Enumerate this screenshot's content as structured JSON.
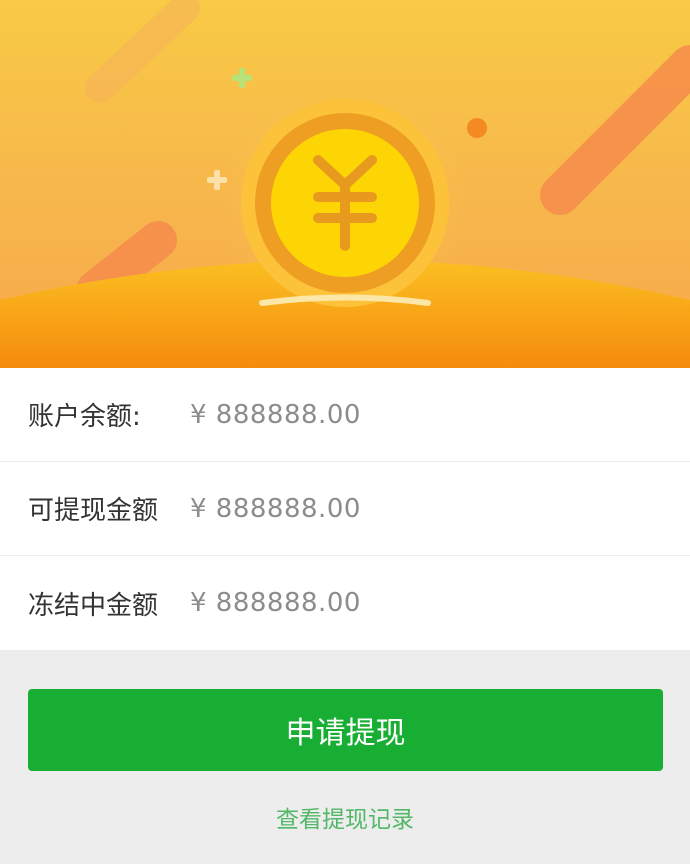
{
  "hero": {
    "icon": "yuan-coin-icon",
    "currency_symbol": "¥"
  },
  "balances": [
    {
      "label": "账户余额:",
      "value": "¥ 888888.00"
    },
    {
      "label": "可提现金额",
      "value": "¥ 888888.00"
    },
    {
      "label": "冻结中金额",
      "value": "¥ 888888.00"
    }
  ],
  "actions": {
    "withdraw_label": "申请提现",
    "records_link": "查看提现记录"
  },
  "colors": {
    "primary_button": "#18ad33",
    "link": "#52b867",
    "hero_yellow": "#f8ca45",
    "hero_orange": "#f7a84a"
  }
}
